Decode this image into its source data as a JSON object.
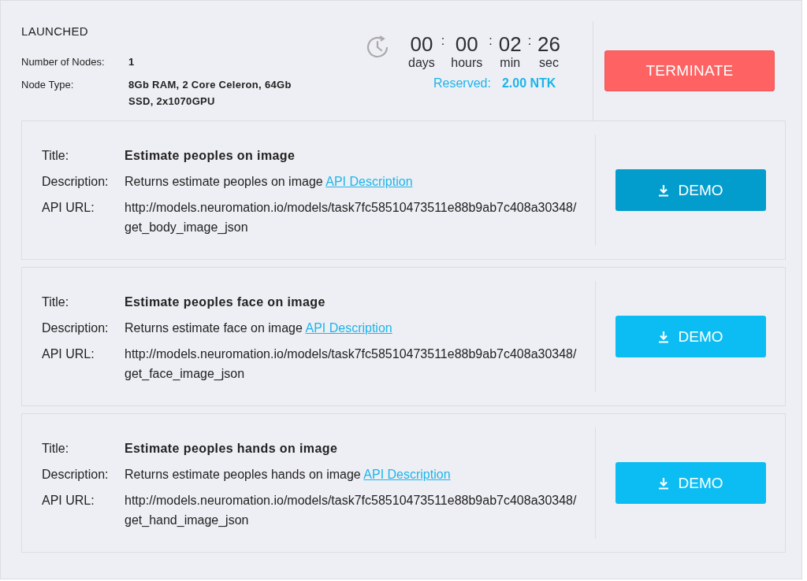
{
  "status": "LAUNCHED",
  "node_info": [
    {
      "label": "Number of Nodes:",
      "value": "1"
    },
    {
      "label": "Node Type:",
      "value": "8Gb RAM, 2 Core Celeron, 64Gb SSD, 2x1070GPU"
    }
  ],
  "timer": [
    {
      "value": "00",
      "unit": "days"
    },
    {
      "value": "00",
      "unit": "hours"
    },
    {
      "value": "02",
      "unit": "min"
    },
    {
      "value": "26",
      "unit": "sec"
    }
  ],
  "timer_separators": [
    ":",
    ":",
    ":"
  ],
  "reserved": {
    "label": "Reserved:",
    "value": "2.00 NTK"
  },
  "terminate_button": "TERMINATE",
  "models": [
    {
      "title_label": "Title:",
      "title": "Estimate peoples on image",
      "description_label": "Description:",
      "description": "Returns estimate peoples on image",
      "link": "API Description",
      "url_label": "API URL:",
      "url": "http://models.neuromation.io/models/task7fc58510473511e88b9ab7c408a30348/get_body_image_json",
      "button": "DEMO",
      "hovered": true
    },
    {
      "title_label": "Title:",
      "title": "Estimate peoples face on image",
      "description_label": "Description:",
      "description": "Returns estimate face on image",
      "link": "API Description",
      "url_label": "API URL:",
      "url": "http://models.neuromation.io/models/task7fc58510473511e88b9ab7c408a30348/get_face_image_json",
      "button": "DEMO",
      "hovered": false
    },
    {
      "title_label": "Title:",
      "title": "Estimate peoples hands on image",
      "description_label": "Description:",
      "description": "Returns estimate peoples hands on image",
      "link": "API Description",
      "url_label": "API URL:",
      "url": "http://models.neuromation.io/models/task7fc58510473511e88b9ab7c408a30348/get_hand_image_json",
      "button": "DEMO",
      "hovered": false
    }
  ]
}
